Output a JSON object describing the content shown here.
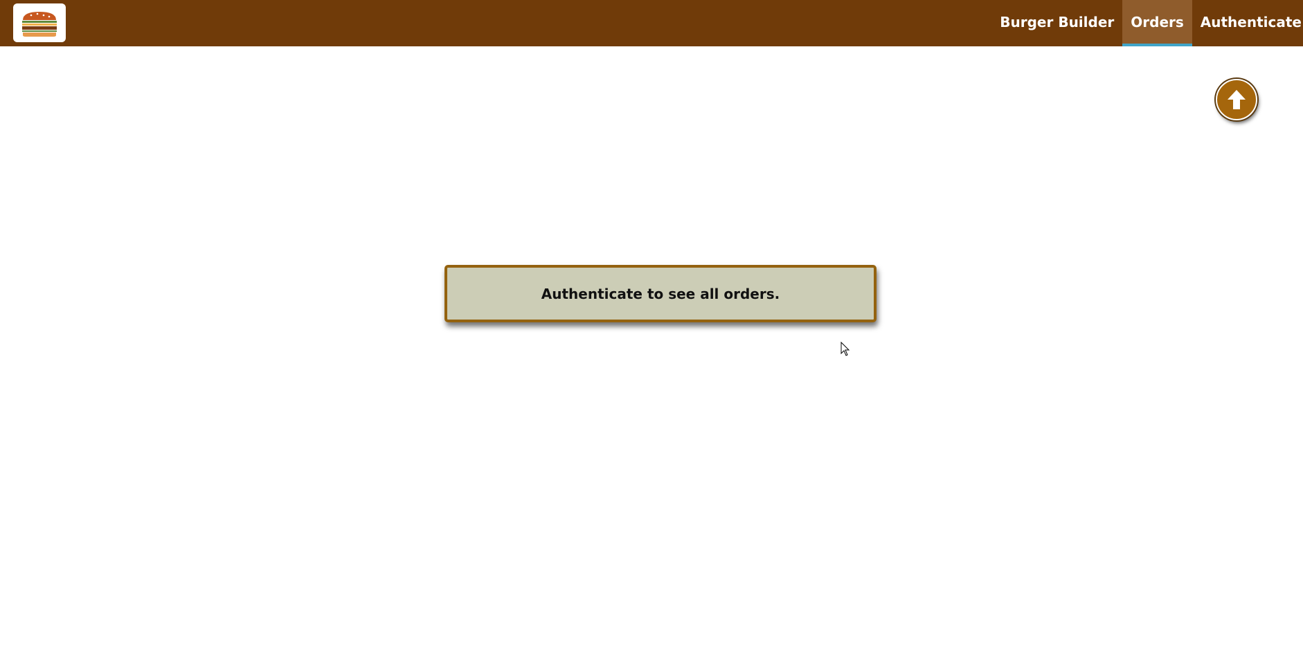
{
  "toolbar": {
    "logo_icon": "burger-logo-icon",
    "nav_items": [
      {
        "label": "Burger Builder",
        "active": false
      },
      {
        "label": "Orders",
        "active": true
      },
      {
        "label": "Authenticate",
        "active": false
      }
    ]
  },
  "main": {
    "message": "Authenticate to see all orders.",
    "scroll_top_icon": "arrow-up-icon"
  },
  "colors": {
    "toolbar_bg": "#703b09",
    "active_nav_bg": "#8f5c2c",
    "active_nav_underline": "#40a4c8",
    "message_bg": "#cccdb6",
    "message_border": "#94620f",
    "scroll_button": "#a5660c"
  }
}
